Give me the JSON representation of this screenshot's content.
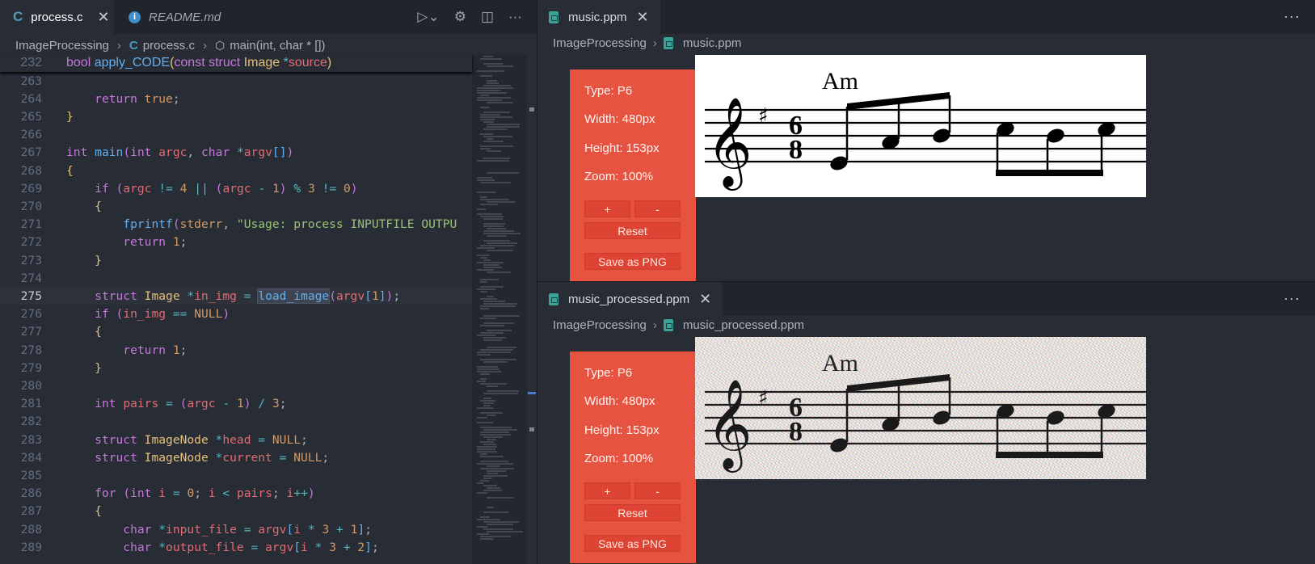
{
  "left": {
    "tabs": [
      {
        "label": "process.c",
        "active": true
      },
      {
        "label": "README.md",
        "active": false
      }
    ],
    "breadcrumb": [
      "ImageProcessing",
      "process.c",
      "main(int, char * [])"
    ],
    "sticky": {
      "number": "232",
      "text": "bool apply_CODE(const struct Image *source)"
    },
    "lines": [
      {
        "n": "263",
        "t": ""
      },
      {
        "n": "264",
        "t": "    return true;"
      },
      {
        "n": "265",
        "t": "}"
      },
      {
        "n": "266",
        "t": ""
      },
      {
        "n": "267",
        "t": "int main(int argc, char *argv[])"
      },
      {
        "n": "268",
        "t": "{"
      },
      {
        "n": "269",
        "t": "    if (argc != 4 || (argc - 1) % 3 != 0)"
      },
      {
        "n": "270",
        "t": "    {"
      },
      {
        "n": "271",
        "t": "        fprintf(stderr, \"Usage: process INPUTFILE OUTPU"
      },
      {
        "n": "272",
        "t": "        return 1;"
      },
      {
        "n": "273",
        "t": "    }"
      },
      {
        "n": "274",
        "t": ""
      },
      {
        "n": "275",
        "t": "    struct Image *in_img = load_image(argv[1]);"
      },
      {
        "n": "276",
        "t": "    if (in_img == NULL)"
      },
      {
        "n": "277",
        "t": "    {"
      },
      {
        "n": "278",
        "t": "        return 1;"
      },
      {
        "n": "279",
        "t": "    }"
      },
      {
        "n": "280",
        "t": ""
      },
      {
        "n": "281",
        "t": "    int pairs = (argc - 1) / 3;"
      },
      {
        "n": "282",
        "t": ""
      },
      {
        "n": "283",
        "t": "    struct ImageNode *head = NULL;"
      },
      {
        "n": "284",
        "t": "    struct ImageNode *current = NULL;"
      },
      {
        "n": "285",
        "t": ""
      },
      {
        "n": "286",
        "t": "    for (int i = 0; i < pairs; i++)"
      },
      {
        "n": "287",
        "t": "    {"
      },
      {
        "n": "288",
        "t": "        char *input_file = argv[i * 3 + 1];"
      },
      {
        "n": "289",
        "t": "        char *output_file = argv[i * 3 + 2];"
      }
    ],
    "current_line": "275"
  },
  "top_pane": {
    "tab": "music.ppm",
    "breadcrumb": [
      "ImageProcessing",
      "music.ppm"
    ],
    "info": {
      "type": "Type: P6",
      "width": "Width: 480px",
      "height": "Height: 153px",
      "zoom": "Zoom: 100%"
    },
    "buttons": {
      "plus": "+",
      "minus": "-",
      "reset": "Reset",
      "save": "Save as PNG"
    },
    "chord": "Am"
  },
  "bottom_pane": {
    "tab": "music_processed.ppm",
    "breadcrumb": [
      "ImageProcessing",
      "music_processed.ppm"
    ],
    "info": {
      "type": "Type: P6",
      "width": "Width: 480px",
      "height": "Height: 153px",
      "zoom": "Zoom: 100%"
    },
    "buttons": {
      "plus": "+",
      "minus": "-",
      "reset": "Reset",
      "save": "Save as PNG"
    },
    "chord": "Am"
  },
  "icons": {
    "more": "ellipsis-icon",
    "close": "close-icon",
    "run": "run-debug-icon",
    "settings": "gear-icon",
    "split": "split-editor-icon"
  },
  "colors": {
    "panel": "#e65341",
    "editor_bg": "#282c34"
  }
}
